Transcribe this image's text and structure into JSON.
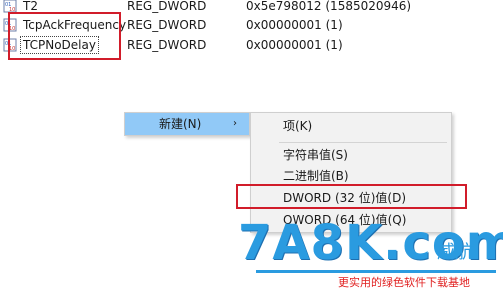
{
  "registry": {
    "rows": [
      {
        "name": "T2",
        "type": "REG_DWORD",
        "data": "0x5e798012 (1585020946)"
      },
      {
        "name": "TcpAckFrequency",
        "type": "REG_DWORD",
        "data": "0x00000001 (1)"
      },
      {
        "name": "TCPNoDelay",
        "type": "REG_DWORD",
        "data": "0x00000001 (1)"
      }
    ]
  },
  "context_menu": {
    "parent_item": {
      "label": "新建(N)",
      "arrow": "›"
    }
  },
  "submenu": {
    "items": [
      {
        "label": "项(K)"
      },
      {
        "label": "字符串值(S)"
      },
      {
        "label": "二进制值(B)"
      },
      {
        "label": "DWORD (32 位)值(D)"
      },
      {
        "label": "QWORD (64 位)值(Q)"
      }
    ]
  },
  "watermark": {
    "logo_text": "7A8K.com",
    "side_text": "威航",
    "tagline": "更实用的绿色软件下载基地"
  },
  "colors": {
    "highlight": "#91c9f7",
    "annotation_red": "#d11c2a",
    "watermark_blue": "#2a9be0"
  }
}
